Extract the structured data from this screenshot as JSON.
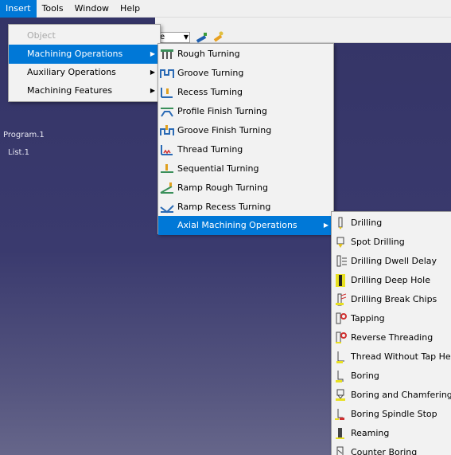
{
  "menubar": {
    "items": [
      {
        "label": "Insert",
        "mnemonic": "I",
        "active": true
      },
      {
        "label": "Tools",
        "mnemonic": "T",
        "active": false
      },
      {
        "label": "Window",
        "mnemonic": "W",
        "active": false
      },
      {
        "label": "Help",
        "mnemonic": "H",
        "active": false
      }
    ]
  },
  "toolbar": {
    "combo_value": "e"
  },
  "tree": {
    "items": [
      "Program.1",
      "List.1"
    ]
  },
  "insert_menu": {
    "items": [
      {
        "label": "Object",
        "disabled": true,
        "submenu": false
      },
      {
        "label": "Machining Operations",
        "highlight": true,
        "submenu": true
      },
      {
        "label": "Auxiliary Operations",
        "submenu": true
      },
      {
        "label": "Machining Features",
        "submenu": true
      }
    ]
  },
  "machining_menu": {
    "items": [
      {
        "label": "Rough Turning",
        "icon": "rough-turning-icon"
      },
      {
        "label": "Groove Turning",
        "icon": "groove-turning-icon"
      },
      {
        "label": "Recess Turning",
        "icon": "recess-turning-icon"
      },
      {
        "label": "Profile Finish Turning",
        "icon": "profile-finish-turning-icon"
      },
      {
        "label": "Groove Finish Turning",
        "icon": "groove-finish-turning-icon"
      },
      {
        "label": "Thread Turning",
        "icon": "thread-turning-icon"
      },
      {
        "label": "Sequential Turning",
        "icon": "sequential-turning-icon"
      },
      {
        "label": "Ramp Rough Turning",
        "icon": "ramp-rough-turning-icon"
      },
      {
        "label": "Ramp Recess Turning",
        "icon": "ramp-recess-turning-icon"
      },
      {
        "label": "Axial Machining Operations",
        "highlight": true,
        "submenu": true
      }
    ]
  },
  "axial_menu": {
    "items": [
      {
        "label": "Drilling",
        "icon": "drilling-icon"
      },
      {
        "label": "Spot Drilling",
        "icon": "spot-drilling-icon"
      },
      {
        "label": "Drilling Dwell Delay",
        "icon": "drilling-dwell-delay-icon"
      },
      {
        "label": "Drilling Deep Hole",
        "icon": "drilling-deep-hole-icon"
      },
      {
        "label": "Drilling Break Chips",
        "icon": "drilling-break-chips-icon"
      },
      {
        "label": "Tapping",
        "icon": "tapping-icon"
      },
      {
        "label": "Reverse Threading",
        "icon": "reverse-threading-icon"
      },
      {
        "label": "Thread Without Tap Hea",
        "icon": "thread-without-tap-head-icon"
      },
      {
        "label": "Boring",
        "icon": "boring-icon"
      },
      {
        "label": "Boring and Chamfering",
        "icon": "boring-chamfering-icon"
      },
      {
        "label": "Boring Spindle Stop",
        "icon": "boring-spindle-stop-icon"
      },
      {
        "label": "Reaming",
        "icon": "reaming-icon"
      },
      {
        "label": "Counter Boring",
        "icon": "counter-boring-icon"
      }
    ]
  },
  "colors": {
    "highlight": "#0078d7",
    "menu_bg": "#f2f2f2",
    "viewport": "#343466"
  }
}
